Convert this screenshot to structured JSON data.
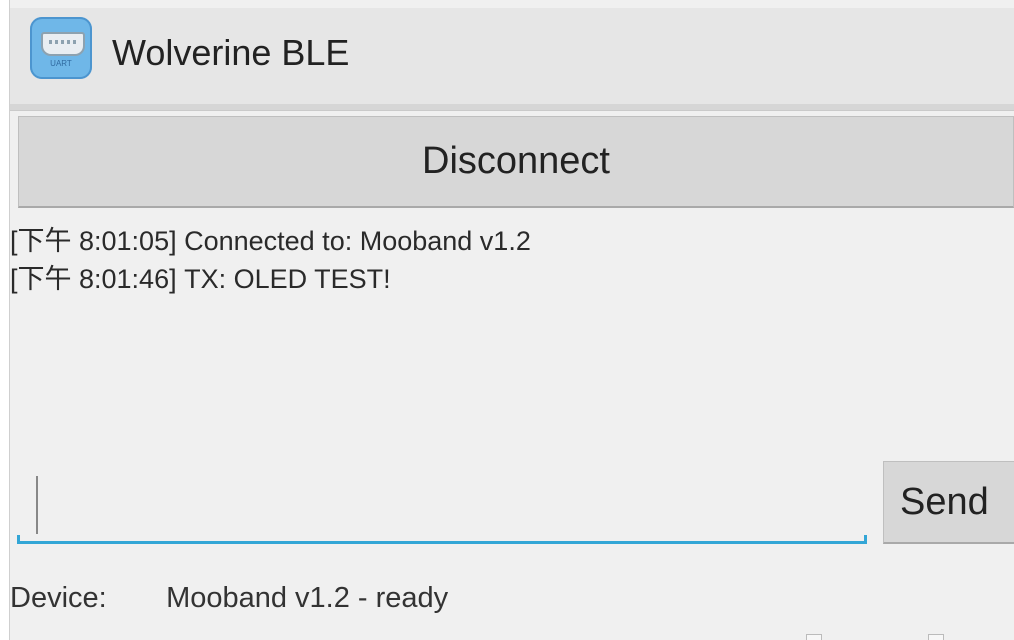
{
  "app": {
    "title": "Wolverine BLE",
    "icon": "uart-connector-icon",
    "icon_caption": "UART"
  },
  "actions": {
    "disconnect_label": "Disconnect"
  },
  "log": {
    "lines": [
      "[下午 8:01:05] Connected to: Mooband v1.2",
      "[下午 8:01:46] TX: OLED TEST!"
    ]
  },
  "composer": {
    "input_value": "",
    "input_placeholder": "",
    "send_label": "Send"
  },
  "status": {
    "label": "Device:",
    "value": "Mooband v1.2 - ready"
  },
  "colors": {
    "accent": "#33a6d6",
    "background": "#f0f0f0",
    "button": "#d7d7d7",
    "action_bar": "#e6e6e6"
  }
}
